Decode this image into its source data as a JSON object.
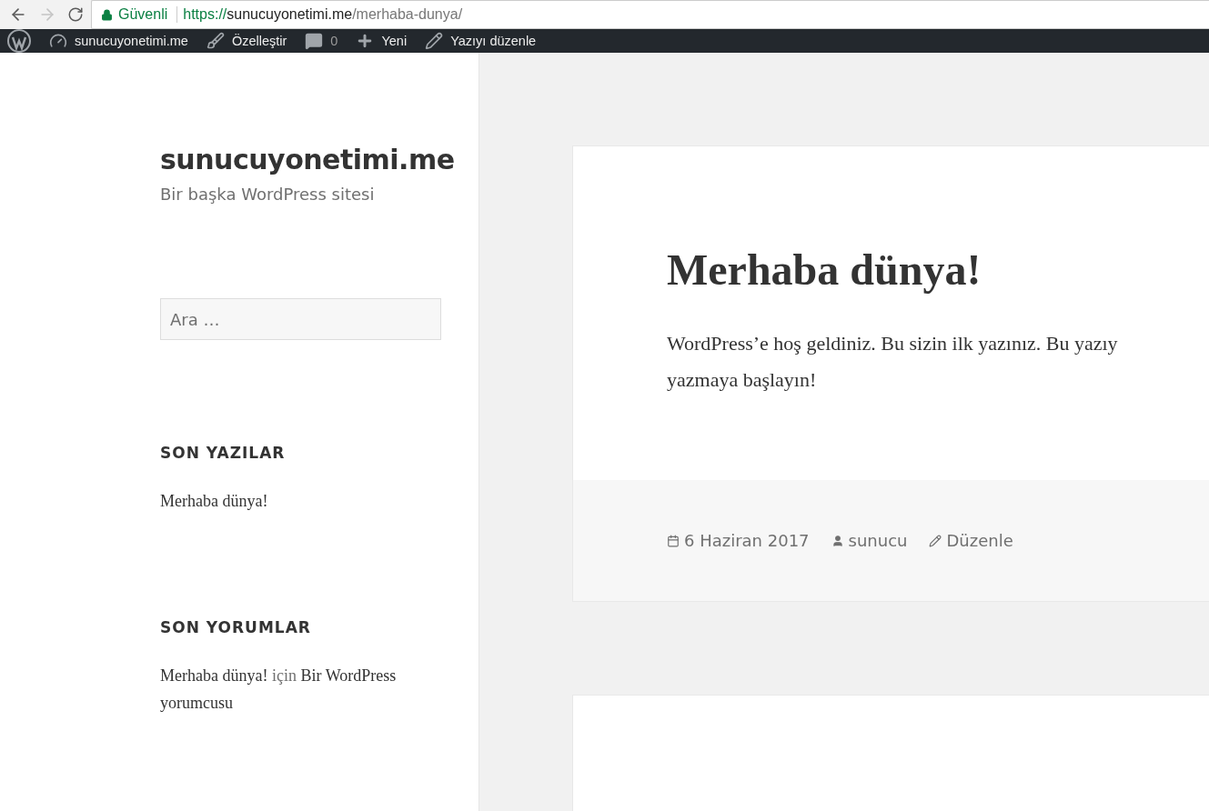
{
  "browser": {
    "security_label": "Güvenli",
    "url_scheme": "https://",
    "url_host": "sunucuyonetimi.me",
    "url_path": "/merhaba-dunya/"
  },
  "admin_bar": {
    "items": [
      {
        "kind": "logo"
      },
      {
        "kind": "site",
        "label": "sunucuyonetimi.me"
      },
      {
        "kind": "customize",
        "label": "Özelleştir"
      },
      {
        "kind": "comments",
        "label": "0"
      },
      {
        "kind": "new",
        "label": "Yeni"
      },
      {
        "kind": "edit",
        "label": "Yazıyı düzenle"
      }
    ]
  },
  "sidebar": {
    "site_title": "sunucuyonetimi.me",
    "tagline": "Bir başka WordPress sitesi",
    "search": {
      "placeholder": "Ara …"
    },
    "widgets": [
      {
        "kind": "posts",
        "title": "SON YAZILAR",
        "items": [
          "Merhaba dünya!"
        ]
      },
      {
        "kind": "comments",
        "title": "SON YORUMLAR",
        "comment": {
          "post": "Merhaba dünya!",
          "conj": "için",
          "author": "Bir WordPress yorumcusu"
        }
      }
    ]
  },
  "post": {
    "title": "Merhaba dünya!",
    "lines": [
      "WordPress’e hoş geldiniz. Bu sizin ilk yazınız. Bu yazıy",
      "yazmaya başlayın!"
    ],
    "meta": [
      {
        "kind": "date",
        "label": "6 Haziran 2017"
      },
      {
        "kind": "author",
        "label": "sunucu"
      },
      {
        "kind": "edit",
        "label": "Düzenle"
      }
    ]
  }
}
